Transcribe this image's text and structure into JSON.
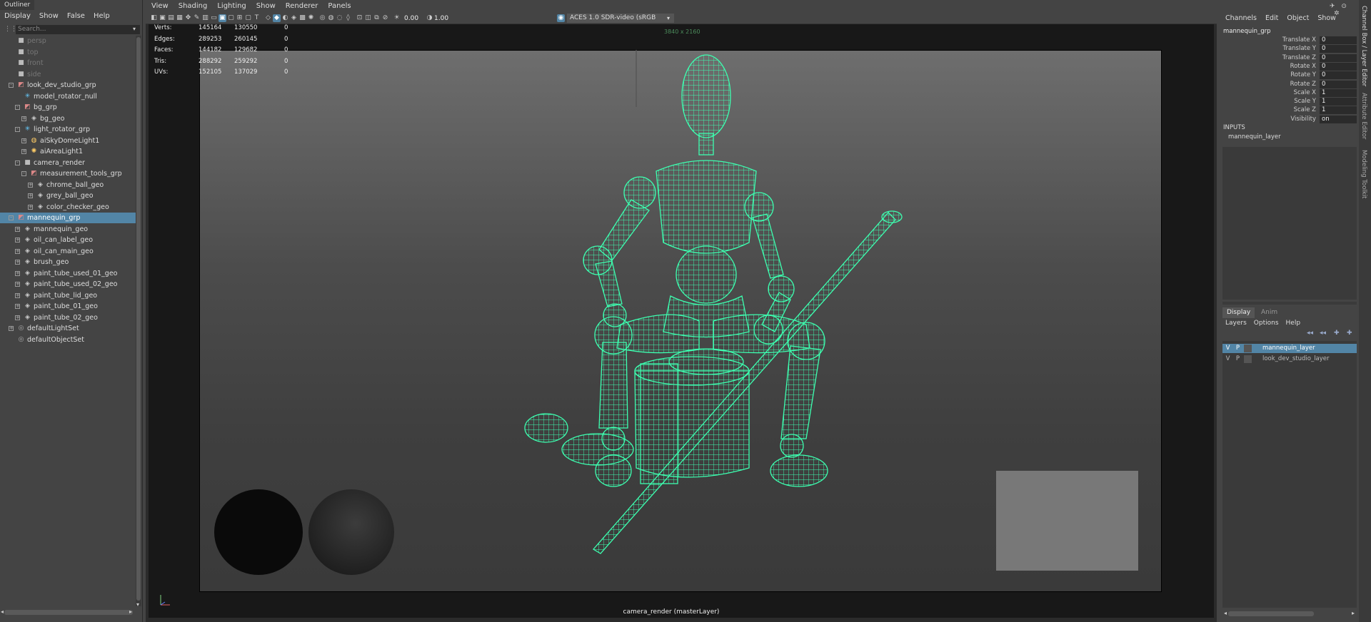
{
  "outliner": {
    "title": "Outliner",
    "menu": [
      "Display",
      "Show",
      "False",
      "Help"
    ],
    "search_placeholder": "Search...",
    "items": [
      {
        "label": "persp",
        "indent": 0,
        "icon": "camera-icon",
        "dim": true,
        "expander": ""
      },
      {
        "label": "top",
        "indent": 0,
        "icon": "camera-icon",
        "dim": true,
        "expander": ""
      },
      {
        "label": "front",
        "indent": 0,
        "icon": "camera-icon",
        "dim": true,
        "expander": ""
      },
      {
        "label": "side",
        "indent": 0,
        "icon": "camera-icon",
        "dim": true,
        "expander": ""
      },
      {
        "label": "look_dev_studio_grp",
        "indent": 0,
        "icon": "group-icon",
        "expander": "-"
      },
      {
        "label": "model_rotator_null",
        "indent": 1,
        "icon": "locator-icon",
        "expander": ""
      },
      {
        "label": "bg_grp",
        "indent": 1,
        "icon": "group-icon",
        "expander": "-"
      },
      {
        "label": "bg_geo",
        "indent": 2,
        "icon": "mesh-icon",
        "expander": "+"
      },
      {
        "label": "light_rotator_grp",
        "indent": 1,
        "icon": "locator-icon",
        "expander": "-"
      },
      {
        "label": "aiSkyDomeLight1",
        "indent": 2,
        "icon": "skydome-icon",
        "expander": "+"
      },
      {
        "label": "aiAreaLight1",
        "indent": 2,
        "icon": "area-light-icon",
        "expander": "+"
      },
      {
        "label": "camera_render",
        "indent": 1,
        "icon": "camera-icon",
        "expander": "-"
      },
      {
        "label": "measurement_tools_grp",
        "indent": 2,
        "icon": "group-icon",
        "expander": "-"
      },
      {
        "label": "chrome_ball_geo",
        "indent": 3,
        "icon": "mesh-icon",
        "expander": "+"
      },
      {
        "label": "grey_ball_geo",
        "indent": 3,
        "icon": "mesh-icon",
        "expander": "+"
      },
      {
        "label": "color_checker_geo",
        "indent": 3,
        "icon": "mesh-icon",
        "expander": "+"
      },
      {
        "label": "mannequin_grp",
        "indent": 0,
        "icon": "group-icon",
        "expander": "-",
        "selected": true
      },
      {
        "label": "mannequin_geo",
        "indent": 1,
        "icon": "mesh-icon",
        "expander": "+"
      },
      {
        "label": "oil_can_label_geo",
        "indent": 1,
        "icon": "mesh-icon",
        "expander": "+"
      },
      {
        "label": "oil_can_main_geo",
        "indent": 1,
        "icon": "mesh-icon",
        "expander": "+"
      },
      {
        "label": "brush_geo",
        "indent": 1,
        "icon": "mesh-icon",
        "expander": "+"
      },
      {
        "label": "paint_tube_used_01_geo",
        "indent": 1,
        "icon": "mesh-icon",
        "expander": "+"
      },
      {
        "label": "paint_tube_used_02_geo",
        "indent": 1,
        "icon": "mesh-icon",
        "expander": "+"
      },
      {
        "label": "paint_tube_lid_geo",
        "indent": 1,
        "icon": "mesh-icon",
        "expander": "+"
      },
      {
        "label": "paint_tube_01_geo",
        "indent": 1,
        "icon": "mesh-icon",
        "expander": "+"
      },
      {
        "label": "paint_tube_02_geo",
        "indent": 1,
        "icon": "mesh-icon",
        "expander": "+"
      },
      {
        "label": "defaultLightSet",
        "indent": 0,
        "icon": "set-icon",
        "expander": "+"
      },
      {
        "label": "defaultObjectSet",
        "indent": 0,
        "icon": "set-icon",
        "expander": ""
      }
    ]
  },
  "viewport": {
    "menu": [
      "View",
      "Shading",
      "Lighting",
      "Show",
      "Renderer",
      "Panels"
    ],
    "exposure": "0.00",
    "gamma": "1.00",
    "color_space": "ACES 1.0 SDR-video (sRGB",
    "resolution_label": "3840 x 2160",
    "camera_label": "camera_render (masterLayer)",
    "hud": [
      {
        "label": "Verts:",
        "a": "145164",
        "b": "130550",
        "c": "0"
      },
      {
        "label": "Edges:",
        "a": "289253",
        "b": "260145",
        "c": "0"
      },
      {
        "label": "Faces:",
        "a": "144182",
        "b": "129682",
        "c": "0"
      },
      {
        "label": "Tris:",
        "a": "288292",
        "b": "259292",
        "c": "0"
      },
      {
        "label": "UVs:",
        "a": "152105",
        "b": "137029",
        "c": "0"
      }
    ],
    "wire_color": "#3dffb0"
  },
  "channel_box": {
    "menu": [
      "Channels",
      "Edit",
      "Object",
      "Show"
    ],
    "node": "mannequin_grp",
    "attributes": [
      {
        "name": "Translate X",
        "value": "0"
      },
      {
        "name": "Translate Y",
        "value": "0"
      },
      {
        "name": "Translate Z",
        "value": "0"
      },
      {
        "name": "Rotate X",
        "value": "0"
      },
      {
        "name": "Rotate Y",
        "value": "0"
      },
      {
        "name": "Rotate Z",
        "value": "0"
      },
      {
        "name": "Scale X",
        "value": "1"
      },
      {
        "name": "Scale Y",
        "value": "1"
      },
      {
        "name": "Scale Z",
        "value": "1"
      },
      {
        "name": "Visibility",
        "value": "on"
      }
    ],
    "inputs_label": "INPUTS",
    "inputs_item": "mannequin_layer"
  },
  "layer_editor": {
    "tabs": [
      "Display",
      "Anim"
    ],
    "menu": [
      "Layers",
      "Options",
      "Help"
    ],
    "layers": [
      {
        "v": "V",
        "p": "P",
        "name": "mannequin_layer",
        "selected": true
      },
      {
        "v": "V",
        "p": "P",
        "name": "look_dev_studio_layer",
        "selected": false
      }
    ]
  },
  "side_tabs": [
    "Channel Box / Layer Editor",
    "Attribute Editor",
    "Modeling Toolkit"
  ],
  "colors": {
    "selection": "#5285a6",
    "panel": "#444444",
    "wireframe": "#3dffb0"
  }
}
